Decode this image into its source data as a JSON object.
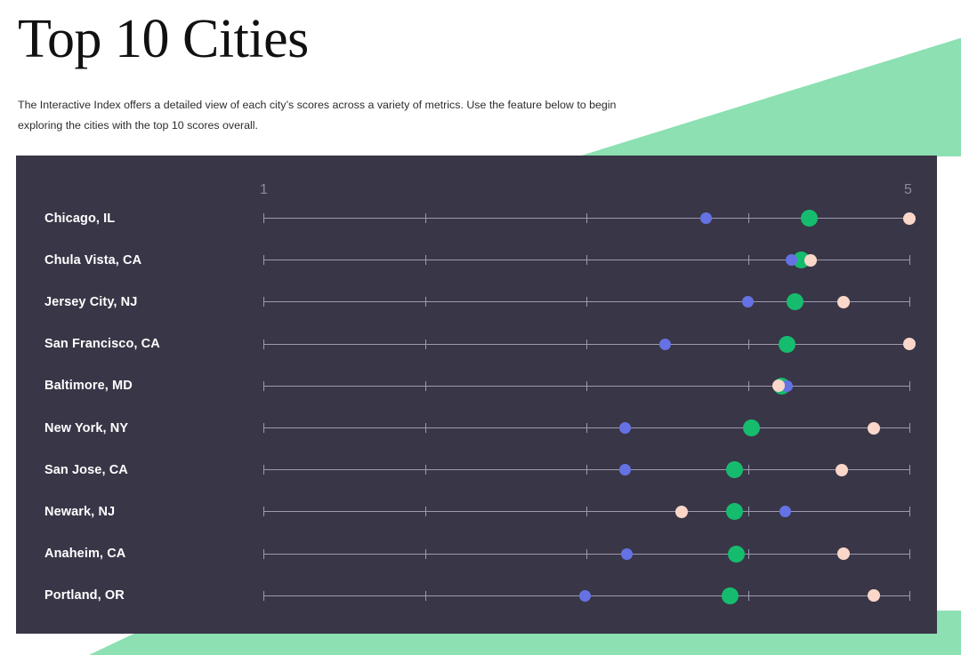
{
  "page": {
    "title": "Top 10 Cities",
    "description": "The Interactive Index offers a detailed view of each city’s scores across a variety of metrics. Use the feature below to begin exploring the cities with the top 10 scores overall."
  },
  "colors": {
    "background": "#ffffff",
    "accent_mint": "#8ce0b2",
    "panel": "#393647",
    "axis": "#9e9aae",
    "axis_label": "#8e8a9c",
    "label_text": "#ffffff",
    "series_blue": "#6572e4",
    "series_green": "#16bc6e",
    "series_peach": "#fad7c9"
  },
  "chart_data": {
    "type": "scatter",
    "title": "Top 10 Cities",
    "xlabel": "",
    "ylabel": "",
    "xlim": [
      1,
      5
    ],
    "axis_min_label": "1",
    "axis_max_label": "5",
    "ticks": [
      1,
      2,
      3,
      4,
      5
    ],
    "grid": false,
    "legend_position": "none",
    "categories": [
      "Chicago, IL",
      "Chula Vista, CA",
      "Jersey City, NJ",
      "San Francisco, CA",
      "Baltimore, MD",
      "New York, NY",
      "San Jose, CA",
      "Newark, NJ",
      "Anaheim, CA",
      "Portland, OR"
    ],
    "series": [
      {
        "name": "blue",
        "color": "#6572e4",
        "values": [
          3.74,
          4.27,
          4.0,
          3.49,
          4.24,
          3.24,
          3.24,
          4.23,
          3.25,
          2.99
        ]
      },
      {
        "name": "green",
        "color": "#16bc6e",
        "values": [
          4.38,
          4.33,
          4.29,
          4.24,
          4.21,
          4.02,
          3.92,
          3.92,
          3.93,
          3.89
        ]
      },
      {
        "name": "peach",
        "color": "#fad7c9",
        "values": [
          5.0,
          4.39,
          4.59,
          5.0,
          4.19,
          4.78,
          4.58,
          3.59,
          4.59,
          4.78
        ]
      }
    ]
  }
}
